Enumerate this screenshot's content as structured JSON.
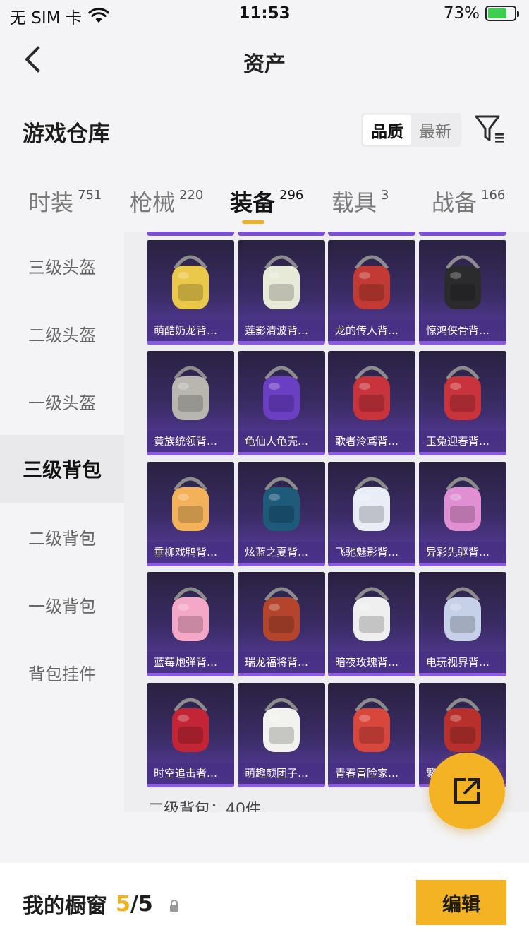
{
  "status_bar": {
    "carrier": "无 SIM 卡",
    "time": "11:53",
    "battery_text": "73%",
    "battery_level": 0.73
  },
  "nav": {
    "title": "资产",
    "back_icon": "chevron-left-icon"
  },
  "section": {
    "title": "游戏仓库",
    "sort_options": [
      "品质",
      "最新"
    ],
    "sort_active": "品质",
    "filter_icon": "filter-icon"
  },
  "tabs": [
    {
      "label": "时装",
      "count": "751"
    },
    {
      "label": "枪械",
      "count": "220"
    },
    {
      "label": "装备",
      "count": "296",
      "active": true
    },
    {
      "label": "载具",
      "count": "3"
    },
    {
      "label": "战备",
      "count": "166"
    }
  ],
  "sidebar": [
    {
      "label": "三级头盔"
    },
    {
      "label": "二级头盔"
    },
    {
      "label": "一级头盔"
    },
    {
      "label": "三级背包",
      "active": true
    },
    {
      "label": "二级背包"
    },
    {
      "label": "一级背包"
    },
    {
      "label": "背包挂件"
    }
  ],
  "items": [
    {
      "name": "萌酷奶龙背…",
      "color": "#e9c84a"
    },
    {
      "name": "莲影清波背…",
      "color": "#e8ead8"
    },
    {
      "name": "龙的传人背…",
      "color": "#c23a33"
    },
    {
      "name": "惊鸿侠骨背…",
      "color": "#2b2b2e"
    },
    {
      "name": "黄族统领背…",
      "color": "#b9b6b0"
    },
    {
      "name": "龟仙人龟壳…",
      "color": "#6a3fc4"
    },
    {
      "name": "歌者泠鸢背…",
      "color": "#c8333c"
    },
    {
      "name": "玉兔迎春背…",
      "color": "#c9343c"
    },
    {
      "name": "垂柳戏鸭背…",
      "color": "#f3b25a"
    },
    {
      "name": "炫蓝之夏背…",
      "color": "#1e5a7a"
    },
    {
      "name": "飞驰魅影背…",
      "color": "#e9eef6"
    },
    {
      "name": "异彩先驱背…",
      "color": "#e08fd2"
    },
    {
      "name": "蓝莓炮弹背…",
      "color": "#f4a7c6"
    },
    {
      "name": "瑞龙福将背…",
      "color": "#b4452c"
    },
    {
      "name": "暗夜玫瑰背…",
      "color": "#efefef"
    },
    {
      "name": "电玩视界背…",
      "color": "#c6d0e8"
    },
    {
      "name": "时空追击者…",
      "color": "#c32536"
    },
    {
      "name": "萌趣颜团子…",
      "color": "#f2f2ee"
    },
    {
      "name": "青春冒险家…",
      "color": "#d9463c"
    },
    {
      "name": "繁…",
      "color": "#b8302c"
    }
  ],
  "peek_text": "二级背包：40件",
  "fab_icon": "share-icon",
  "bottom": {
    "label": "我的橱窗",
    "used": "5",
    "total": "/5",
    "lock_icon": "lock-icon",
    "edit_label": "编辑"
  }
}
